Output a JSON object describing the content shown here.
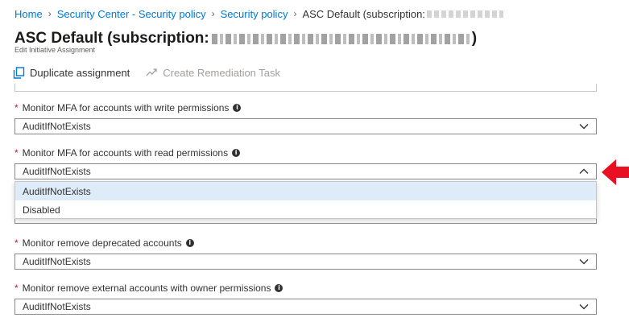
{
  "breadcrumb": {
    "items": [
      "Home",
      "Security Center - Security policy",
      "Security policy"
    ],
    "current": "ASC Default (subscription: "
  },
  "header": {
    "title": "ASC Default (subscription: ",
    "title_tail": ")",
    "subtitle": "Edit Initiative Assignment"
  },
  "toolbar": {
    "duplicate_label": "Duplicate assignment",
    "remediation_label": "Create Remediation Task"
  },
  "fields": [
    {
      "label": "Monitor MFA for accounts with write permissions",
      "value": "AuditIfNotExists",
      "expanded": false
    },
    {
      "label": "Monitor MFA for accounts with read permissions",
      "value": "AuditIfNotExists",
      "expanded": true
    },
    {
      "label": "Monitor remove deprecated accounts",
      "value": "AuditIfNotExists",
      "expanded": false
    },
    {
      "label": "Monitor remove external accounts with owner permissions",
      "value": "AuditIfNotExists",
      "expanded": false
    }
  ],
  "dropdown": {
    "options": [
      "AuditIfNotExists",
      "Disabled"
    ],
    "selected_index": 0
  },
  "required_marker": "*",
  "colors": {
    "link": "#0078d4",
    "required": "#a4262c",
    "selected_option": "#deecf9",
    "arrow": "#e81123"
  }
}
